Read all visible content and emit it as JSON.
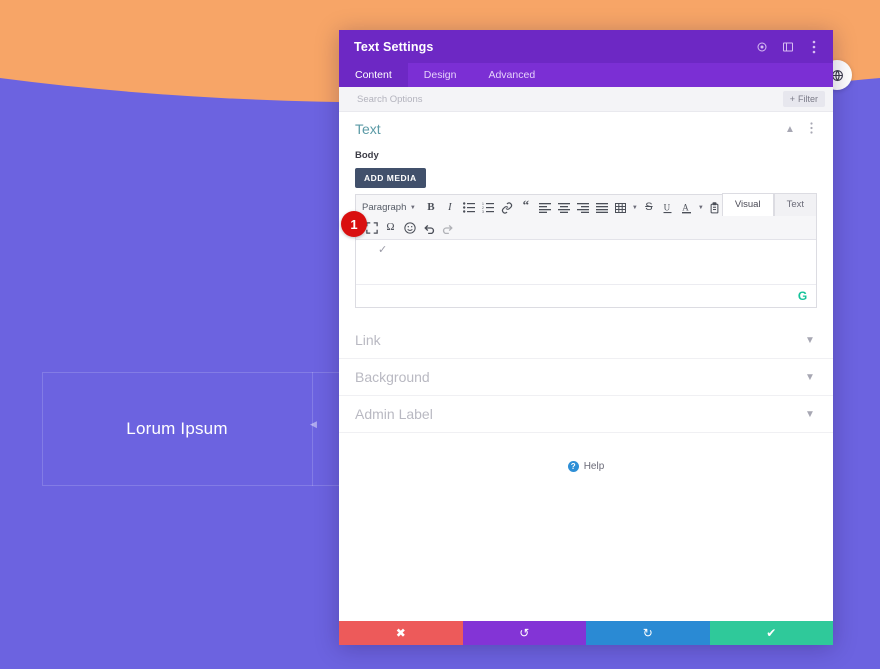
{
  "canvas": {
    "bg_color": "#6c63e0",
    "curve_color": "#f7a567",
    "hero_label": "Lorum Ipsum",
    "fab_icon": "globe-icon"
  },
  "modal": {
    "title": "Text Settings",
    "titlebar_icons": [
      {
        "name": "target-icon",
        "glyph": "◉"
      },
      {
        "name": "panel-layout-icon",
        "glyph": "▯"
      },
      {
        "name": "kebab-menu-icon",
        "glyph": "⋮"
      }
    ],
    "tabs": [
      {
        "label": "Content",
        "active": true
      },
      {
        "label": "Design",
        "active": false
      },
      {
        "label": "Advanced",
        "active": false
      }
    ],
    "search": {
      "placeholder": "Search Options",
      "value": "",
      "filter_label": "Filter",
      "filter_icon": "plus-icon"
    },
    "sections": [
      {
        "label": "Text",
        "open": true,
        "chevron": "chevron-up-icon"
      },
      {
        "label": "Link",
        "open": false,
        "chevron": "chevron-down-icon"
      },
      {
        "label": "Background",
        "open": false,
        "chevron": "chevron-down-icon"
      },
      {
        "label": "Admin Label",
        "open": false,
        "chevron": "chevron-down-icon"
      }
    ],
    "text_section": {
      "field_label": "Body",
      "add_media_label": "ADD MEDIA",
      "editor_tabs": [
        {
          "label": "Visual",
          "active": true
        },
        {
          "label": "Text",
          "active": false
        }
      ],
      "format_select": "Paragraph",
      "toolbar_row1": [
        {
          "name": "bold-icon",
          "glyph": "B"
        },
        {
          "name": "italic-icon",
          "glyph": "I"
        },
        {
          "name": "bulleted-list-icon",
          "glyph": "ul"
        },
        {
          "name": "numbered-list-icon",
          "glyph": "ol"
        },
        {
          "name": "link-icon",
          "glyph": "link"
        },
        {
          "name": "blockquote-icon",
          "glyph": "“"
        },
        {
          "name": "align-left-icon",
          "glyph": "al"
        },
        {
          "name": "align-center-icon",
          "glyph": "ac"
        },
        {
          "name": "align-right-icon",
          "glyph": "ar"
        },
        {
          "name": "align-justify-icon",
          "glyph": "aj"
        },
        {
          "name": "table-icon",
          "glyph": "tbl"
        },
        {
          "name": "strikethrough-icon",
          "glyph": "S"
        },
        {
          "name": "underline-icon",
          "glyph": "U"
        },
        {
          "name": "text-color-icon",
          "glyph": "A"
        },
        {
          "name": "paste-as-text-icon",
          "glyph": "paste"
        },
        {
          "name": "clear-formatting-icon",
          "glyph": "Tx"
        },
        {
          "name": "decrease-indent-icon",
          "glyph": "di"
        },
        {
          "name": "increase-indent-icon",
          "glyph": "ii"
        }
      ],
      "toolbar_row2": [
        {
          "name": "fullscreen-icon",
          "glyph": "fs"
        },
        {
          "name": "special-character-icon",
          "glyph": "Ω"
        },
        {
          "name": "emoji-icon",
          "glyph": "☺"
        },
        {
          "name": "undo-icon",
          "glyph": "undo"
        },
        {
          "name": "redo-icon",
          "glyph": "redo"
        }
      ],
      "body_value": "",
      "grammarly_badge": "G"
    },
    "help": {
      "label": "Help",
      "icon": "question-mark-icon"
    },
    "footer_buttons": [
      {
        "name": "discard-button",
        "icon": "close-icon",
        "glyph": "✖",
        "color": "#ed5a5a"
      },
      {
        "name": "undo-button",
        "icon": "undo-icon",
        "glyph": "↺",
        "color": "#8334d6"
      },
      {
        "name": "redo-button",
        "icon": "redo-icon",
        "glyph": "↻",
        "color": "#2a8ad4"
      },
      {
        "name": "save-button",
        "icon": "check-icon",
        "glyph": "✔",
        "color": "#2fc99a"
      }
    ]
  },
  "annotation": {
    "step_number": "1",
    "badge_color": "#d90f0f"
  }
}
